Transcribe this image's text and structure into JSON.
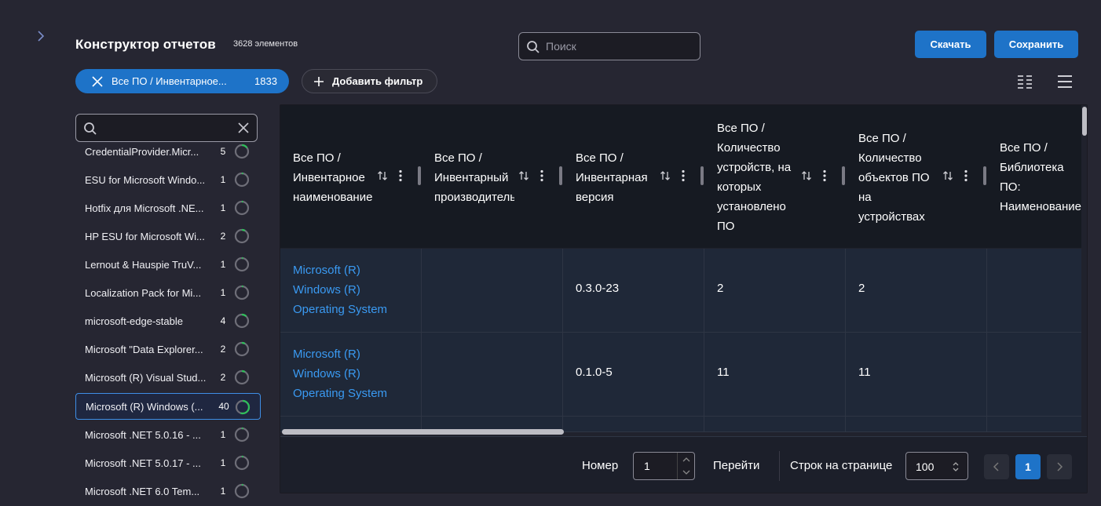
{
  "header": {
    "title": "Конструктор отчетов",
    "item_count": "3628 элементов",
    "search_placeholder": "Поиск",
    "download_label": "Скачать",
    "save_label": "Сохранить"
  },
  "filter_chip": {
    "label": "Все ПО / Инвентарное...",
    "count": "1833"
  },
  "add_filter_label": "Добавить фильтр",
  "sidebar": {
    "search_value": "",
    "items": [
      {
        "name": "CredentialProvider.Micr...",
        "count": "5",
        "progress": 0.15
      },
      {
        "name": "ESU for Microsoft Windo...",
        "count": "1",
        "progress": 0.03
      },
      {
        "name": "Hotfix для Microsoft .NE...",
        "count": "1",
        "progress": 0.03
      },
      {
        "name": "HP ESU for Microsoft Wi...",
        "count": "2",
        "progress": 0.08
      },
      {
        "name": "Lernout & Hauspie TruV...",
        "count": "1",
        "progress": 0.03
      },
      {
        "name": "Localization Pack for Mi...",
        "count": "1",
        "progress": 0.03
      },
      {
        "name": "microsoft-edge-stable",
        "count": "4",
        "progress": 0.12
      },
      {
        "name": "Microsoft \"Data Explorer...",
        "count": "2",
        "progress": 0.08
      },
      {
        "name": "Microsoft (R) Visual Stud...",
        "count": "2",
        "progress": 0.08
      },
      {
        "name": "Microsoft (R) Windows (...",
        "count": "40",
        "progress": 0.55,
        "selected": true
      },
      {
        "name": "Microsoft .NET 5.0.16 - ...",
        "count": "1",
        "progress": 0.03
      },
      {
        "name": "Microsoft .NET 5.0.17 - ...",
        "count": "1",
        "progress": 0.03
      },
      {
        "name": "Microsoft .NET 6.0 Tem...",
        "count": "1",
        "progress": 0.03
      }
    ]
  },
  "table": {
    "columns": [
      {
        "lines": [
          "Все ПО /",
          "Инвентарное",
          "наименование"
        ]
      },
      {
        "lines": [
          "Все ПО /",
          "Инвентарный",
          "производитель"
        ]
      },
      {
        "lines": [
          "Все ПО /",
          "Инвентарная",
          "версия"
        ]
      },
      {
        "lines": [
          "Все ПО /",
          "Количество",
          "устройств, на",
          "которых",
          "установлено",
          "ПО"
        ]
      },
      {
        "lines": [
          "Все ПО /",
          "Количество",
          "объектов ПО",
          "на",
          "устройствах"
        ]
      },
      {
        "lines": [
          "Все ПО /",
          "Библиотека",
          "ПО:",
          "Наименование"
        ]
      }
    ],
    "rows": [
      {
        "name": [
          "Microsoft (R)",
          "Windows (R)",
          "Operating System"
        ],
        "vendor": "",
        "version": "0.3.0-23",
        "devices": "2",
        "objects": "2",
        "library": ""
      },
      {
        "name": [
          "Microsoft (R)",
          "Windows (R)",
          "Operating System"
        ],
        "vendor": "",
        "version": "0.1.0-5",
        "devices": "11",
        "objects": "11",
        "library": ""
      }
    ]
  },
  "pager": {
    "number_label": "Номер",
    "number_value": "1",
    "go_label": "Перейти",
    "rows_label": "Строк на странице",
    "rows_value": "100",
    "current_page": "1"
  },
  "colors": {
    "accent": "#1e73c8",
    "link": "#3a9af2",
    "background": "#262632",
    "progress": "#2fbf5a"
  }
}
